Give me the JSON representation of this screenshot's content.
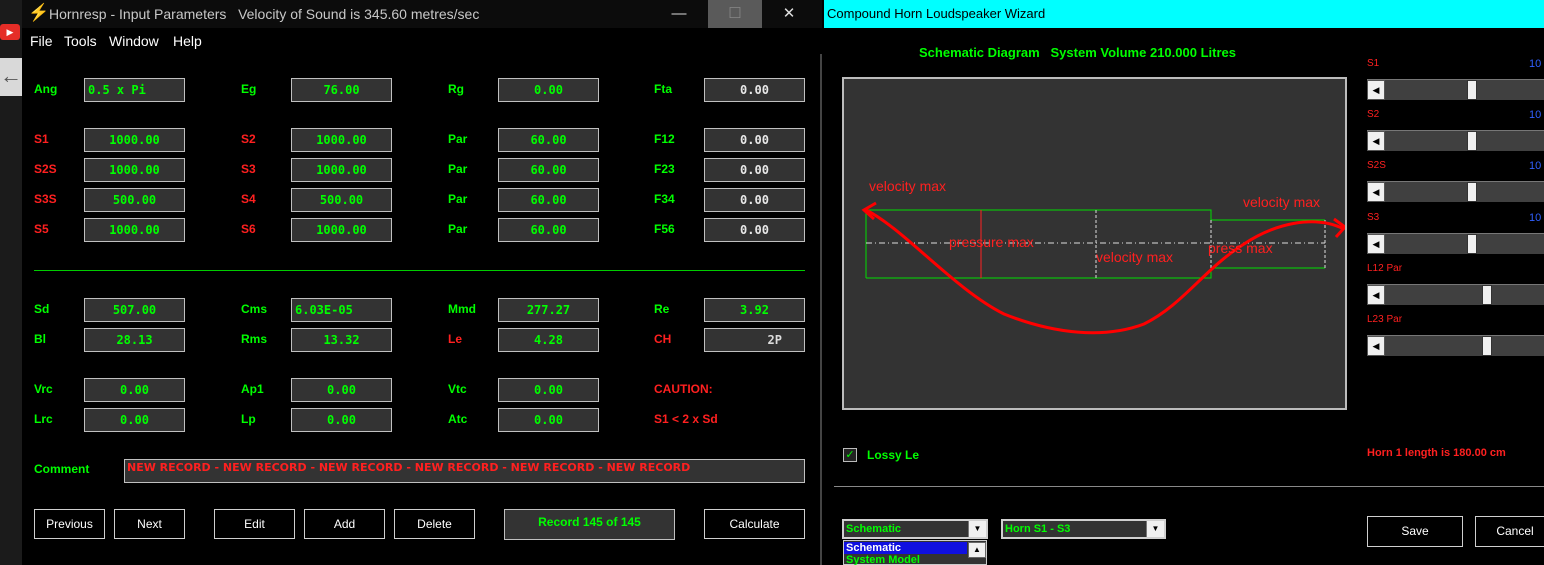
{
  "hornresp": {
    "title": "Hornresp - Input Parameters   Velocity of Sound is 345.60 metres/sec",
    "menu": [
      "File",
      "Tools",
      "Window",
      "Help"
    ],
    "row1": [
      {
        "label": "Ang",
        "value": "0.5 x Pi"
      },
      {
        "label": "Eg",
        "value": "76.00"
      },
      {
        "label": "Rg",
        "value": "0.00"
      },
      {
        "label": "Fta",
        "value": "0.00"
      }
    ],
    "grid": [
      [
        {
          "label": "S1",
          "value": "1000.00"
        },
        {
          "label": "S2",
          "value": "1000.00"
        },
        {
          "label": "Par",
          "value": "60.00"
        },
        {
          "label": "F12",
          "value": "0.00"
        }
      ],
      [
        {
          "label": "S2S",
          "value": "1000.00"
        },
        {
          "label": "S3",
          "value": "1000.00"
        },
        {
          "label": "Par",
          "value": "60.00"
        },
        {
          "label": "F23",
          "value": "0.00"
        }
      ],
      [
        {
          "label": "S3S",
          "value": "500.00"
        },
        {
          "label": "S4",
          "value": "500.00"
        },
        {
          "label": "Par",
          "value": "60.00"
        },
        {
          "label": "F34",
          "value": "0.00"
        }
      ],
      [
        {
          "label": "S5",
          "value": "1000.00"
        },
        {
          "label": "S6",
          "value": "1000.00"
        },
        {
          "label": "Par",
          "value": "60.00"
        },
        {
          "label": "F56",
          "value": "0.00"
        }
      ]
    ],
    "driver": [
      [
        {
          "label": "Sd",
          "value": "507.00"
        },
        {
          "label": "Cms",
          "value": "6.03E-05"
        },
        {
          "label": "Mmd",
          "value": "277.27"
        },
        {
          "label": "Re",
          "value": "3.92"
        }
      ],
      [
        {
          "label": "Bl",
          "value": "28.13"
        },
        {
          "label": "Rms",
          "value": "13.32"
        },
        {
          "label": "Le",
          "value": "4.28"
        },
        {
          "label": "CH",
          "value": "2P"
        }
      ]
    ],
    "chamber": [
      [
        {
          "label": "Vrc",
          "value": "0.00"
        },
        {
          "label": "Ap1",
          "value": "0.00"
        },
        {
          "label": "Vtc",
          "value": "0.00"
        }
      ],
      [
        {
          "label": "Lrc",
          "value": "0.00"
        },
        {
          "label": "Lp",
          "value": "0.00"
        },
        {
          "label": "Atc",
          "value": "0.00"
        }
      ]
    ],
    "caution_title": "CAUTION:",
    "caution_text": "S1 < 2 x Sd",
    "comment_label": "Comment",
    "comment_value": "NEW RECORD - NEW RECORD - NEW RECORD - NEW RECORD - NEW RECORD - NEW RECORD",
    "buttons": {
      "previous": "Previous",
      "next": "Next",
      "edit": "Edit",
      "add": "Add",
      "delete": "Delete",
      "calculate": "Calculate"
    },
    "record": "Record 145 of 145"
  },
  "wizard": {
    "title": "Compound Horn Loudspeaker Wizard",
    "schematic_title": "Schematic Diagram   System Volume 210.000 Litres",
    "annotations": {
      "vel_left": "velocity max",
      "vel_right": "velocity max",
      "pressure_max": "pressure max",
      "vel_mid": "velocity max",
      "press_max": "press max"
    },
    "sliders": [
      {
        "label": "S1",
        "num": "10",
        "level": 0.55
      },
      {
        "label": "S2",
        "num": "10",
        "level": 0.55
      },
      {
        "label": "S2S",
        "num": "10",
        "level": 0.55
      },
      {
        "label": "S3",
        "num": "10",
        "level": 0.55
      },
      {
        "label": "L12  Par",
        "num": "",
        "level": 0.65
      },
      {
        "label": "L23  Par",
        "num": "",
        "level": 0.65
      }
    ],
    "lossy_label": "Lossy Le",
    "lossy_checked": "✓",
    "horn_length": "Horn 1 length is 180.00 cm",
    "combo1": "Schematic",
    "combo2": "Horn S1 - S3",
    "dropdown_options": [
      "Schematic",
      "System Model"
    ],
    "save_label": "Save",
    "cancel_label": "Cancel"
  },
  "icons": {
    "bolt": "lightning-icon",
    "minimize": "—",
    "maximize": "☐",
    "close": "✕"
  }
}
